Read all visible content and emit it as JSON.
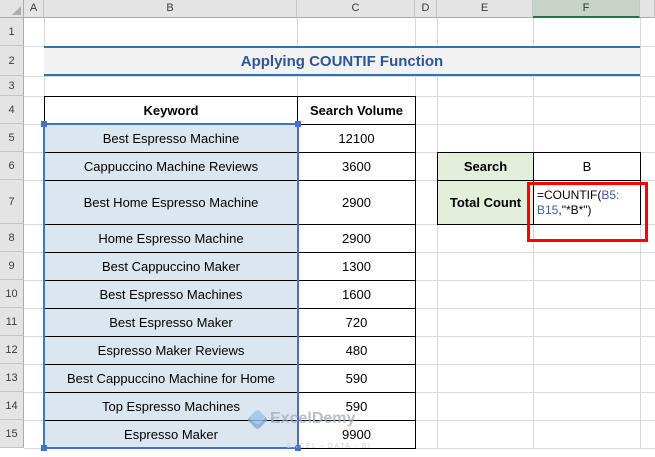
{
  "sheet": {
    "columns": [
      "A",
      "B",
      "C",
      "D",
      "E",
      "F"
    ],
    "rows": [
      "1",
      "2",
      "3",
      "4",
      "5",
      "6",
      "7",
      "8",
      "9",
      "10",
      "11",
      "12",
      "13",
      "14",
      "15"
    ],
    "selected_column": "F"
  },
  "title": {
    "text": "Applying COUNTIF Function"
  },
  "main_table": {
    "headers": {
      "keyword": "Keyword",
      "volume": "Search Volume"
    },
    "rows": [
      {
        "keyword": "Best Espresso Machine",
        "volume": "12100"
      },
      {
        "keyword": "Cappuccino Machine Reviews",
        "volume": "3600"
      },
      {
        "keyword": "Best Home Espresso Machine",
        "volume": "2900"
      },
      {
        "keyword": "Home Espresso Machine",
        "volume": "2900"
      },
      {
        "keyword": "Best Cappuccino Maker",
        "volume": "1300"
      },
      {
        "keyword": "Best Espresso Machines",
        "volume": "1600"
      },
      {
        "keyword": "Best Espresso Maker",
        "volume": "720"
      },
      {
        "keyword": "Espresso Maker Reviews",
        "volume": "480"
      },
      {
        "keyword": "Best Cappuccino Machine for Home",
        "volume": "590"
      },
      {
        "keyword": "Top Espresso Machines",
        "volume": "590"
      },
      {
        "keyword": "Espresso Maker",
        "volume": "9900"
      }
    ]
  },
  "search_table": {
    "search_label": "Search",
    "search_value": "B",
    "total_label": "Total Count",
    "formula": {
      "line1_fn": "=COUNTIF(",
      "line1_ref": "B5:",
      "line2_ref": "B15",
      "line2_rest": ",\"*B*\")"
    }
  },
  "watermark": {
    "brand": "ExcelDemy",
    "tagline": "EXCEL - DATA - BI"
  },
  "colors": {
    "accent_blue": "#4472C4",
    "title_blue": "#2F5597",
    "title_border_blue": "#2E74B5",
    "green_fill": "#E2EFDA",
    "selection_fill": "#DCE6F1",
    "reference_blue": "#3C5EAE",
    "annotation_red": "#FF0000"
  }
}
